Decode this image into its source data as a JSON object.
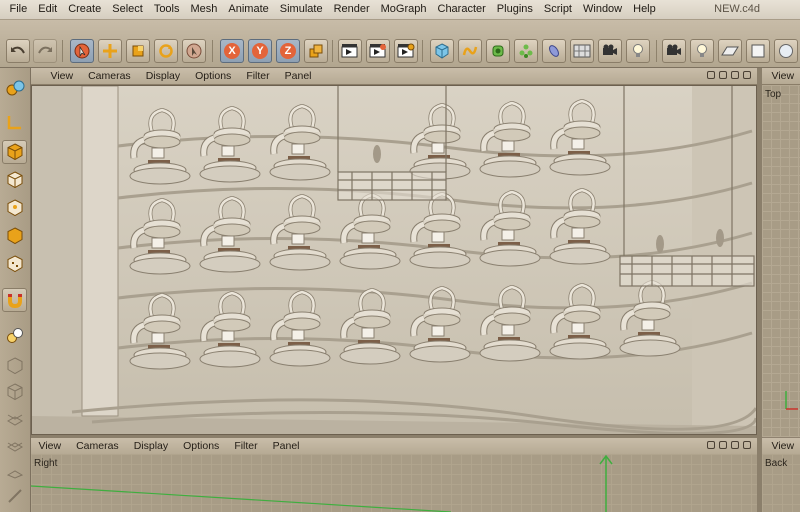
{
  "app": {
    "file_title": "NEW.c4d",
    "menu": [
      "File",
      "Edit",
      "Create",
      "Select",
      "Tools",
      "Mesh",
      "Animate",
      "Simulate",
      "Render",
      "MoGraph",
      "Character",
      "Plugins",
      "Script",
      "Window",
      "Help"
    ]
  },
  "toolbar": {
    "axis_x": "X",
    "axis_y": "Y",
    "axis_z": "Z",
    "tools": [
      "undo-icon",
      "redo-icon",
      "live-selection-icon",
      "move-icon",
      "scale-icon",
      "rotate-icon",
      "recent-tool-icon",
      "x-axis-lock-icon",
      "y-axis-lock-icon",
      "z-axis-lock-icon",
      "coordinate-system-icon",
      "render-view-icon",
      "render-picture-viewer-icon",
      "render-settings-icon",
      "cube-object-icon",
      "spline-icon",
      "nurbs-icon",
      "array-icon",
      "deformer-icon",
      "scene-floor-icon",
      "camera-icon",
      "light-icon"
    ],
    "right_tools": [
      "camera-icon",
      "light-icon",
      "floor-icon",
      "background-icon",
      "sky-icon"
    ]
  },
  "left_tools": [
    "make-editable-icon",
    "axis-mode-icon",
    "model-mode-icon",
    "object-mode-icon",
    "points-mode-icon",
    "edges-mode-icon",
    "polygons-mode-icon",
    "snap-magnet-icon",
    "enable-snap-icon",
    "workplane-icon",
    "texture-mode-icon",
    "uv-points-icon",
    "uv-polygons-icon",
    "soft-selection-icon"
  ],
  "viewports": {
    "menu": [
      "View",
      "Cameras",
      "Display",
      "Options",
      "Filter",
      "Panel"
    ],
    "top_label": "Top",
    "right_label": "Right",
    "back_label": "Back",
    "side_menu_view": "View"
  },
  "colors": {
    "selection_blue": "#8ea0b3",
    "axis_green": "#3fae3f",
    "axis_red": "#c8322a"
  }
}
